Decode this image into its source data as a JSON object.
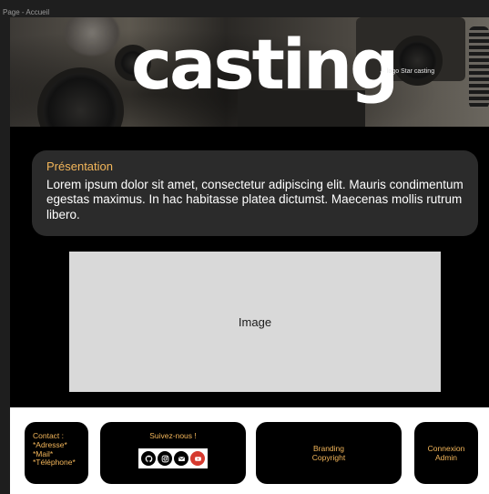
{
  "frame": {
    "label": "Page - Accueil"
  },
  "hero": {
    "logo_text": "casting",
    "logo_note": "← logo Star casting"
  },
  "presentation": {
    "title": "Présentation",
    "text": "Lorem ipsum dolor sit amet, consectetur adipiscing elit. Mauris condimentum egestas maximus. In hac habitasse platea dictumst. Maecenas mollis rutrum libero."
  },
  "image_placeholder": {
    "label": "Image"
  },
  "footer": {
    "contact": {
      "lines": [
        "Contact :",
        "*Adresse*",
        "*Mail*",
        "*Téléphone*"
      ]
    },
    "social": {
      "title": "Suivez-nous !",
      "icons": [
        "github-icon",
        "instagram-icon",
        "mail-icon",
        "youtube-icon"
      ]
    },
    "branding": {
      "lines": [
        "Branding",
        "Copyright"
      ]
    },
    "admin": {
      "lines": [
        "Connexion",
        "Admin"
      ]
    }
  },
  "colors": {
    "accent": "#f3b65a",
    "card_bg": "#2b2b2b",
    "placeholder_bg": "#d9d9d9",
    "youtube_red": "#d63a2f"
  }
}
